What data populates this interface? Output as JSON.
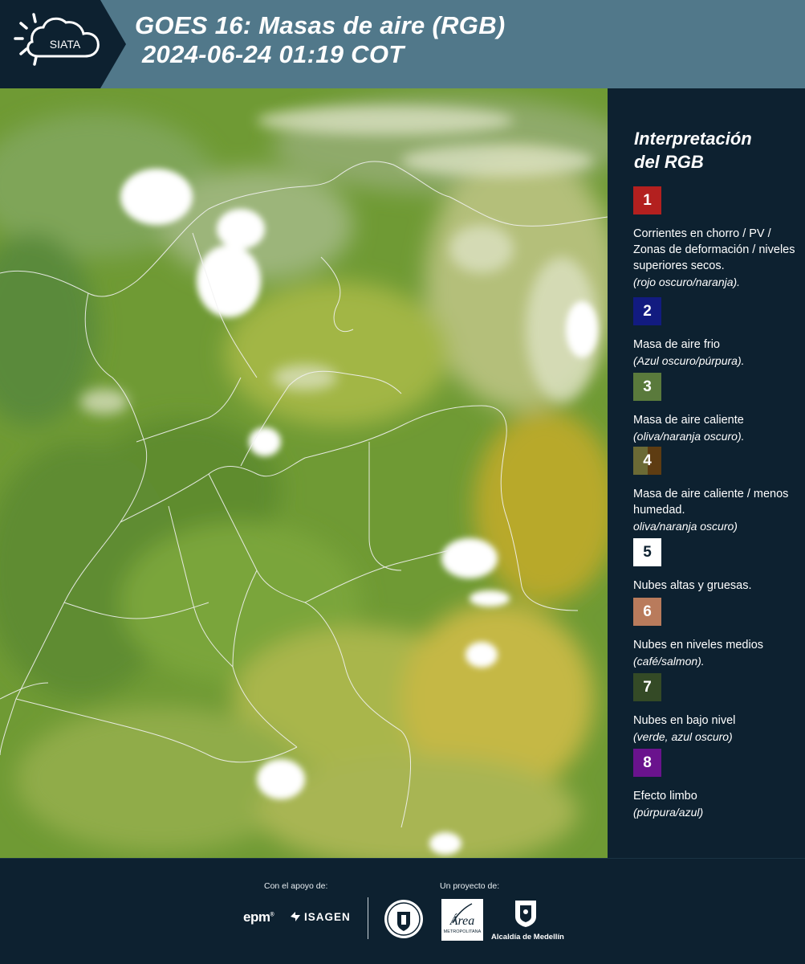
{
  "header": {
    "logo_text": "SIATA",
    "title_line1": "GOES 16: Masas de aire (RGB)",
    "title_line2": "2024-06-24 01:19 COT"
  },
  "map": {
    "image_kind": "satellite-rgb-airmass",
    "dominant_colors": [
      "#6f9a34",
      "#9fb84a",
      "#d8d7b4",
      "#ffffff",
      "#c9b53a"
    ]
  },
  "legend": {
    "title_line1": "Interpretación",
    "title_line2": "del RGB",
    "items": [
      {
        "num": "1",
        "color": "#b3201f",
        "text": "Corrientes en chorro / PV / Zonas de deformación / niveles superiores secos.",
        "note": "(rojo oscuro/naranja)."
      },
      {
        "num": "2",
        "color": "#121b80",
        "text": "Masa de aire frio",
        "note": "(Azul oscuro/púrpura)."
      },
      {
        "num": "3",
        "color": "#5a7a3c",
        "text": "Masa de aire caliente",
        "note": "(oliva/naranja oscuro)."
      },
      {
        "num": "4",
        "color": "#6b6a35",
        "color2": "#5e3c12",
        "text": "Masa de aire caliente / menos humedad.",
        "note": "oliva/naranja oscuro)"
      },
      {
        "num": "5",
        "color": "#ffffff",
        "text": "Nubes altas y gruesas.",
        "note": ""
      },
      {
        "num": "6",
        "color": "#b97b5c",
        "text": "Nubes en niveles medios",
        "note": "(café/salmon)."
      },
      {
        "num": "7",
        "color": "#344a26",
        "text": "Nubes en bajo nivel",
        "note": "(verde, azul oscuro)"
      },
      {
        "num": "8",
        "color": "#6a138d",
        "text": "Efecto limbo",
        "note": "(púrpura/azul)"
      }
    ]
  },
  "footer": {
    "support_label": "Con el apoyo de:",
    "project_label": "Un proyecto de:",
    "epm": "epm",
    "isagen": "ISAGEN",
    "area_text": "Área",
    "area_sub": "METROPOLITANA",
    "alcaldia": "Alcaldía de Medellín"
  }
}
